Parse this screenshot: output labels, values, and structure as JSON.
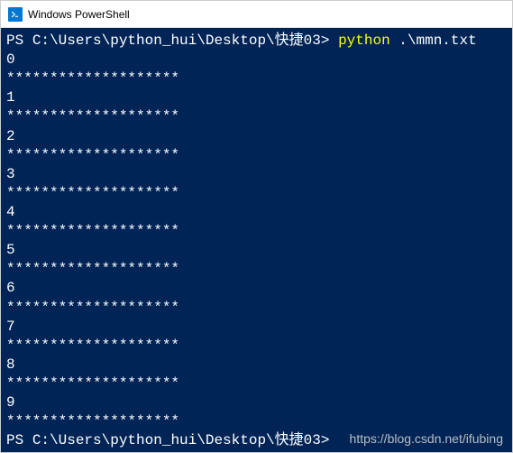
{
  "window": {
    "title": "Windows PowerShell"
  },
  "terminal": {
    "prompt1_prefix": "PS ",
    "prompt1_path": "C:\\Users\\python_hui\\Desktop\\快捷03",
    "prompt1_gt": "> ",
    "command": "python",
    "command_args": " .\\mmn.txt",
    "separator": "********************",
    "output": [
      "0",
      "1",
      "2",
      "3",
      "4",
      "5",
      "6",
      "7",
      "8",
      "9"
    ],
    "prompt2_prefix": "PS ",
    "prompt2_path": "C:\\Users\\python_hui\\Desktop\\快捷03",
    "prompt2_gt": ">"
  },
  "watermark": "https://blog.csdn.net/ifubing"
}
